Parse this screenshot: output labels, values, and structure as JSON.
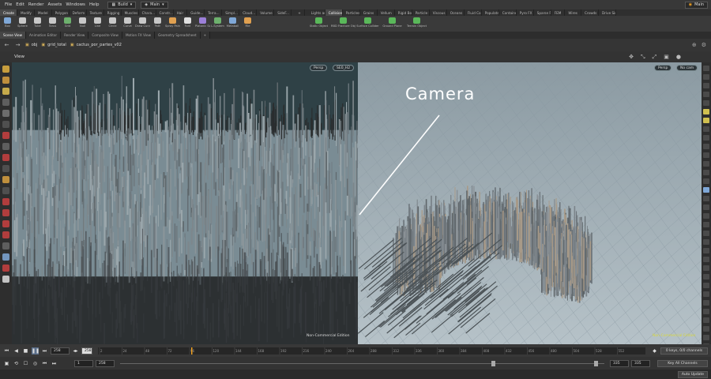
{
  "menu": {
    "items": [
      "File",
      "Edit",
      "Render",
      "Assets",
      "Windows",
      "Help"
    ],
    "desktop": "Build",
    "context": "Main",
    "right_context": "Main"
  },
  "shelf_tabs_left": [
    "Create",
    "Modify",
    "Model",
    "Polygon",
    "Deform",
    "Texture",
    "Rigging",
    "Muscles",
    "Chara...",
    "Constr...",
    "Hair",
    "Guide...",
    "Terra...",
    "Simpl...",
    "Cloud...",
    "Volume",
    "SideF..."
  ],
  "shelf_tabs_right": [
    "Lights and",
    "Collisions",
    "Particles",
    "Grains",
    "Vellum",
    "Rigid Bodies",
    "Particle Fl...",
    "Viscous Fl...",
    "Oceans",
    "Fluid Con...",
    "Populate C...",
    "Container...",
    "Pyro FX",
    "Sparse Pyr...",
    "FEM",
    "Wires",
    "Crowds",
    "Drive Sim"
  ],
  "tools_left": [
    "Box",
    "Sphere",
    "Tube",
    "Torus",
    "Grid",
    "Null",
    "Line",
    "Circle",
    "Curve",
    "Draw Curve",
    "Path",
    "Spray Paint",
    "Font",
    "Platonic Solids",
    "L-System",
    "Metaball",
    "File"
  ],
  "tools_right": [
    "Static Object",
    "RBD Fracture Object",
    "Surface Collider",
    "Ground Plane",
    "Terrain Object"
  ],
  "pane_tabs": [
    "Scene View",
    "Animation Editor",
    "Render View",
    "Composite View",
    "Motion FX View",
    "Geometry Spreadsheet"
  ],
  "path": {
    "root": "obj",
    "node1": "grid_total",
    "node2": "cactus_por_partes_v02"
  },
  "viewport": {
    "label": "View",
    "left": {
      "persp": "Persp",
      "cam": "SE0_H2",
      "watermark": "Non-Commercial Edition"
    },
    "right": {
      "persp": "Persp",
      "cam": "No cam",
      "watermark": "Non-Commercial Edition"
    }
  },
  "annotation": {
    "text": "Camera"
  },
  "playbar": {
    "frame": "258",
    "frame_box": "258",
    "ticks": [
      "2",
      "24",
      "48",
      "72",
      "96",
      "120",
      "144",
      "168",
      "192",
      "216",
      "240",
      "264",
      "288",
      "312",
      "336",
      "360",
      "384",
      "408",
      "432",
      "456",
      "480",
      "504",
      "528",
      "552"
    ],
    "keys_info": "0 keys, 0/0 channels",
    "key_all": "Key All Channels"
  },
  "range": {
    "start": "1",
    "end_a": "258",
    "end_b": "335",
    "end_c": "335"
  },
  "status": {
    "auto_update": "Auto Update"
  },
  "colors": {
    "accent": "#f0a020",
    "viewport_left_bg": "#3d474b",
    "viewport_right_bg": "#a9b6bc",
    "stick": "#6c747a"
  }
}
